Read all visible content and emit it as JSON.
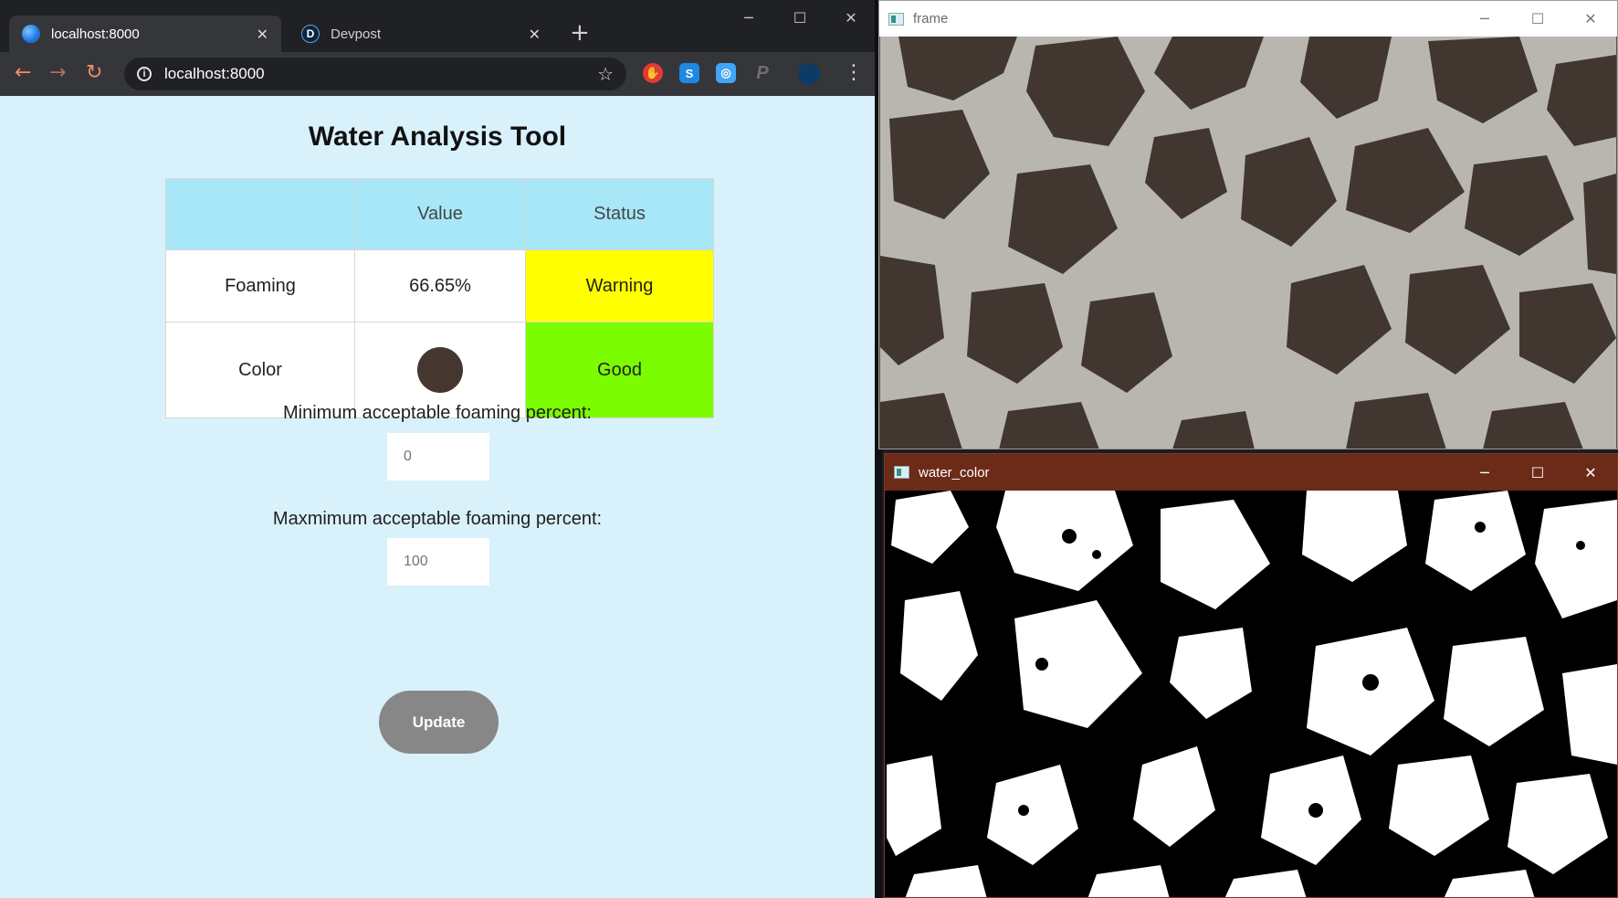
{
  "browser": {
    "tabs": [
      {
        "title": "localhost:8000",
        "icon": "globe-icon",
        "active": true
      },
      {
        "title": "Devpost",
        "icon": "devpost-d-icon",
        "favicon_letter": "D",
        "active": false
      }
    ],
    "address": "localhost:8000",
    "extensions": [
      {
        "name": "hand-stop-extension-icon",
        "color": "#e53935"
      },
      {
        "name": "s-extension-icon",
        "letter": "S",
        "color": "#1e88e5"
      },
      {
        "name": "circle-target-extension-icon",
        "color": "#42a5f5"
      },
      {
        "name": "p-extension-icon",
        "letter": "P",
        "color": "#616161"
      },
      {
        "name": "profile-avatar",
        "color": "#0d3b66"
      }
    ]
  },
  "page": {
    "title": "Water Analysis Tool",
    "table": {
      "headers": [
        "",
        "Value",
        "Status"
      ],
      "rows": [
        {
          "label": "Foaming",
          "value": "66.65%",
          "status": "Warning",
          "status_color": "#ffff00"
        },
        {
          "label": "Color",
          "value_swatch_color": "#45372f",
          "status": "Good",
          "status_color": "#7cfc00"
        }
      ]
    },
    "min_label": "Minimum acceptable foaming percent:",
    "min_placeholder": "0",
    "max_label": "Maxmimum acceptable foaming percent:",
    "max_placeholder": "100",
    "update_label": "Update"
  },
  "windows": {
    "frame_title": "frame",
    "water_title": "water_color"
  },
  "colors": {
    "page_bg": "#d9f1fb",
    "header_bg": "#a7e7f8",
    "button_bg": "#878787",
    "water_titlebar": "#6c2b18"
  }
}
